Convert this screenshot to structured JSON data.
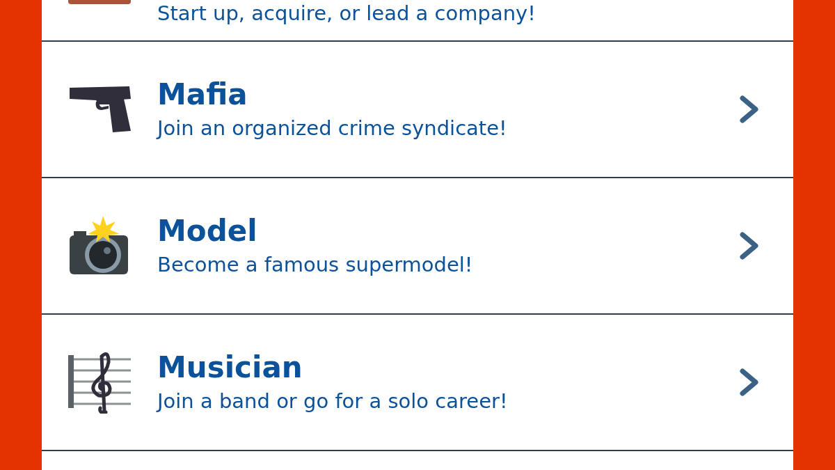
{
  "partial_row": {
    "subtitle": "Start up, acquire, or lead a company!",
    "kind": "briefcase"
  },
  "careers": [
    {
      "title": "Mafia",
      "subtitle": "Join an organized crime syndicate!",
      "kind": "pistol"
    },
    {
      "title": "Model",
      "subtitle": "Become a famous supermodel!",
      "kind": "camera"
    },
    {
      "title": "Musician",
      "subtitle": "Join a band or go for a solo career!",
      "kind": "music"
    }
  ]
}
